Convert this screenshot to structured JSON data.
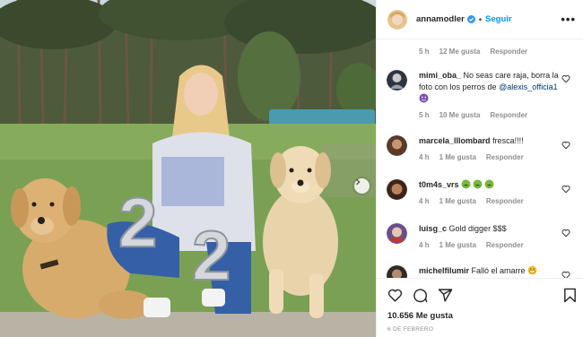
{
  "post": {
    "username": "annamodler",
    "follow_label": "Seguir",
    "separator": "•",
    "more_label": "•••"
  },
  "top_comment_meta": {
    "time": "5 h",
    "likes": "12 Me gusta",
    "reply": "Responder"
  },
  "comments": [
    {
      "user": "mimi_oba_",
      "text": "No seas care raja, borra la foto con los perros de",
      "mention": "@alexis_officia1",
      "emoji": "purple-face",
      "time": "5 h",
      "likes": "10 Me gusta",
      "reply": "Responder"
    },
    {
      "user": "marcela_lllombard",
      "text": "fresca!!!!",
      "time": "4 h",
      "likes": "1 Me gusta",
      "reply": "Responder"
    },
    {
      "user": "t0m4s_vrs",
      "text": "",
      "emoji": "green-laughing-faces",
      "time": "4 h",
      "likes": "1 Me gusta",
      "reply": "Responder"
    },
    {
      "user": "luisg_c",
      "text": "Gold digger $$$",
      "time": "4 h",
      "likes": "1 Me gusta",
      "reply": "Responder"
    },
    {
      "user": "michelfilumir",
      "text": "Falló el amarre",
      "emoji": "grimacing-face"
    }
  ],
  "likes_count": "10.656 Me gusta",
  "date": "6 DE FEBRERO",
  "photo": {
    "balloon_number": "22"
  },
  "colors": {
    "follow": "#0095f6",
    "meta": "#8e8e8e",
    "mention": "#00376b"
  }
}
